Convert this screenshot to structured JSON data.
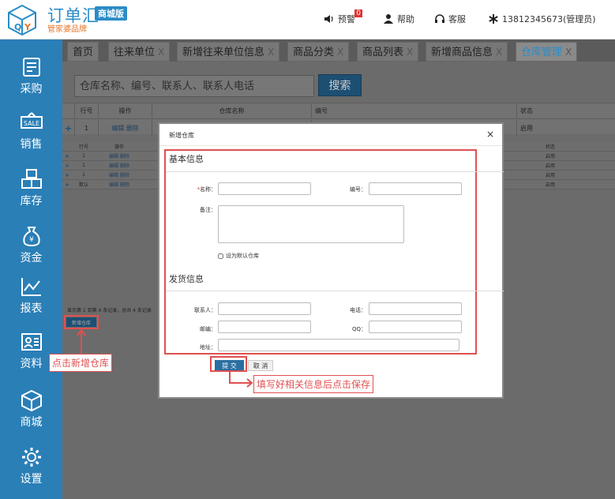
{
  "header": {
    "brand_title": "订单汇",
    "brand_badge": "商城版",
    "brand_sub": "管家婆品牌",
    "alert_label": "预警",
    "alert_count": "0",
    "help_label": "帮助",
    "service_label": "客服",
    "user_label": "13812345673(管理员)"
  },
  "sidebar": {
    "items": [
      {
        "label": "采购",
        "icon": "cart-icon"
      },
      {
        "label": "销售",
        "icon": "sale-icon"
      },
      {
        "label": "库存",
        "icon": "boxes-icon"
      },
      {
        "label": "资金",
        "icon": "money-bag-icon"
      },
      {
        "label": "报表",
        "icon": "chart-icon"
      },
      {
        "label": "资料",
        "icon": "profile-card-icon"
      },
      {
        "label": "商城",
        "icon": "package-icon"
      },
      {
        "label": "设置",
        "icon": "gear-icon"
      }
    ]
  },
  "tabs": [
    {
      "label": "首页",
      "closable": false
    },
    {
      "label": "往来单位",
      "closable": true
    },
    {
      "label": "新增往来单位信息",
      "closable": true
    },
    {
      "label": "商品分类",
      "closable": true
    },
    {
      "label": "商品列表",
      "closable": true
    },
    {
      "label": "新增商品信息",
      "closable": true
    },
    {
      "label": "仓库管理",
      "closable": true,
      "active": true
    }
  ],
  "close_glyph": "X",
  "search": {
    "placeholder": "仓库名称、编号、联系人、联系人电话",
    "button_label": "搜索"
  },
  "grid": {
    "columns": [
      "行号",
      "操作",
      "仓库名称",
      "编号",
      "状态"
    ],
    "row": {
      "plus": "+",
      "no": "1",
      "ops": "编辑 删除",
      "status": "启用"
    }
  },
  "subgrid": {
    "columns": [
      "行号",
      "操作",
      "状态"
    ],
    "rows": [
      {
        "no": "1",
        "ops": "编辑 删除",
        "status": "启用"
      },
      {
        "no": "1",
        "ops": "编辑 删除",
        "status": "启用"
      },
      {
        "no": "1",
        "ops": "编辑 删除",
        "status": "启用"
      },
      {
        "no": "默认",
        "ops": "编辑 删除",
        "status": "启用"
      }
    ]
  },
  "pager_text": "显示第 1 到第 4 条记录，总共 4 条记录",
  "add_warehouse_label": "新增仓库",
  "modal": {
    "title": "新增仓库",
    "close_glyph": "×",
    "basic_section": "基本信息",
    "name_required": "*",
    "name_label": "名称：",
    "code_label": "编号：",
    "note_label": "备注：",
    "default_checkbox_label": "设为默认仓库",
    "ship_section": "发货信息",
    "contact_label": "联系人：",
    "phone_label": "电话：",
    "zip_label": "邮编：",
    "qq_label": "QQ：",
    "address_label": "地址：",
    "submit_label": "提 交",
    "cancel_label": "取 消"
  },
  "annotations": {
    "click_add": "点击新增仓库",
    "fill_save": "填写好相关信息后点击保存"
  },
  "colors": {
    "brand_blue": "#2a8cc7",
    "sidebar_blue": "#2a7fb7",
    "annotation_red": "#e05050"
  }
}
